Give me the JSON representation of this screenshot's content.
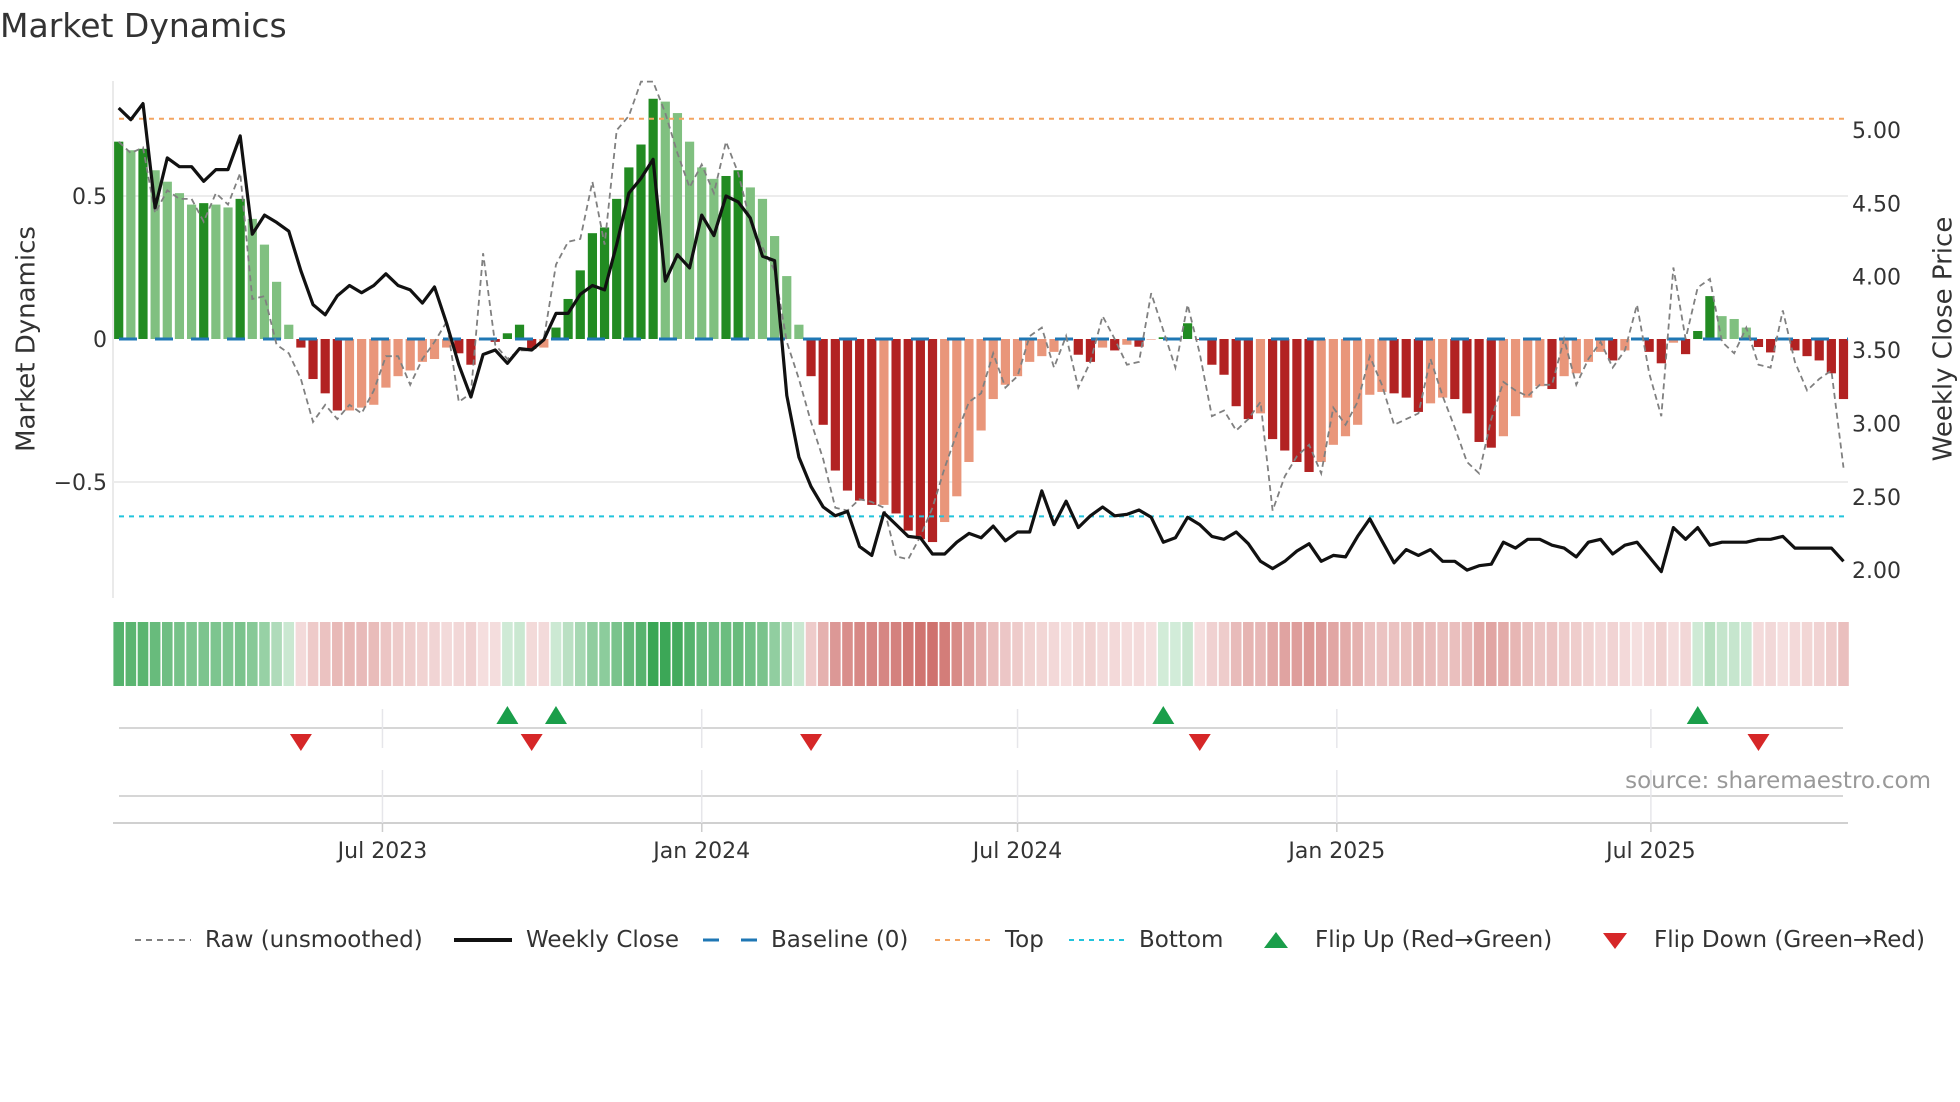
{
  "title": "Market Dynamics",
  "source": "source: sharemaestro.com",
  "legend": {
    "raw": "Raw (unsmoothed)",
    "close": "Weekly Close",
    "baseline": "Baseline (0)",
    "top": "Top",
    "bottom": "Bottom",
    "flip_up": "Flip Up (Red→Green)",
    "flip_down": "Flip Down (Green→Red)"
  },
  "colors": {
    "green_dark": "#228b22",
    "green_light": "#80c080",
    "red_dark": "#b22222",
    "red_light": "#e9967a",
    "raw": "#808080",
    "close": "#111111",
    "baseline": "#1f77b4",
    "top": "#f4a460",
    "bottom": "#22c3dc",
    "flip_up": "#1a9e4a",
    "flip_down": "#d62728"
  },
  "chart_data": {
    "type": "bar",
    "title": "Market Dynamics",
    "ylabel": "Market Dynamics",
    "y2label": "Weekly Close Price",
    "ylim": [
      -0.905,
      0.9
    ],
    "y2lim": [
      1.81,
      5.33
    ],
    "yticks": [
      {
        "v": 0.5,
        "label": "0.5"
      },
      {
        "v": 0,
        "label": "0"
      },
      {
        "v": -0.5,
        "label": "−0.5"
      }
    ],
    "y2ticks": [
      {
        "v": 5.0,
        "label": "5.00"
      },
      {
        "v": 4.5,
        "label": "4.50"
      },
      {
        "v": 4.0,
        "label": "4.00"
      },
      {
        "v": 3.5,
        "label": "3.50"
      },
      {
        "v": 3.0,
        "label": "3.00"
      },
      {
        "v": 2.5,
        "label": "2.50"
      },
      {
        "v": 2.0,
        "label": "2.00"
      }
    ],
    "xticks": [
      {
        "date": "2023-07-01",
        "label": "Jul 2023"
      },
      {
        "date": "2024-01-01",
        "label": "Jan 2024"
      },
      {
        "date": "2024-07-01",
        "label": "Jul 2024"
      },
      {
        "date": "2025-01-01",
        "label": "Jan 2025"
      },
      {
        "date": "2025-07-01",
        "label": "Jul 2025"
      }
    ],
    "top_level": 0.77,
    "bottom_level": -0.62,
    "baseline": 0,
    "grid": true,
    "legend_position": "bottom",
    "x": [
      "2023-01-30",
      "2023-02-06",
      "2023-02-13",
      "2023-02-20",
      "2023-02-27",
      "2023-03-06",
      "2023-03-13",
      "2023-03-20",
      "2023-03-27",
      "2023-04-03",
      "2023-04-10",
      "2023-04-17",
      "2023-04-24",
      "2023-05-01",
      "2023-05-08",
      "2023-05-15",
      "2023-05-22",
      "2023-05-29",
      "2023-06-05",
      "2023-06-12",
      "2023-06-19",
      "2023-06-26",
      "2023-07-03",
      "2023-07-10",
      "2023-07-17",
      "2023-07-24",
      "2023-07-31",
      "2023-08-07",
      "2023-08-14",
      "2023-08-21",
      "2023-08-28",
      "2023-09-04",
      "2023-09-11",
      "2023-09-18",
      "2023-09-25",
      "2023-10-02",
      "2023-10-09",
      "2023-10-16",
      "2023-10-23",
      "2023-10-30",
      "2023-11-06",
      "2023-11-13",
      "2023-11-20",
      "2023-11-27",
      "2023-12-04",
      "2023-12-11",
      "2023-12-18",
      "2023-12-25",
      "2024-01-01",
      "2024-01-08",
      "2024-01-15",
      "2024-01-22",
      "2024-01-29",
      "2024-02-05",
      "2024-02-12",
      "2024-02-19",
      "2024-02-26",
      "2024-03-04",
      "2024-03-11",
      "2024-03-18",
      "2024-03-25",
      "2024-04-01",
      "2024-04-08",
      "2024-04-15",
      "2024-04-22",
      "2024-04-29",
      "2024-05-06",
      "2024-05-13",
      "2024-05-20",
      "2024-05-27",
      "2024-06-03",
      "2024-06-10",
      "2024-06-17",
      "2024-06-24",
      "2024-07-01",
      "2024-07-08",
      "2024-07-15",
      "2024-07-22",
      "2024-07-29",
      "2024-08-05",
      "2024-08-12",
      "2024-08-19",
      "2024-08-26",
      "2024-09-02",
      "2024-09-09",
      "2024-09-16",
      "2024-09-23",
      "2024-09-30",
      "2024-10-07",
      "2024-10-14",
      "2024-10-21",
      "2024-10-28",
      "2024-11-04",
      "2024-11-11",
      "2024-11-18",
      "2024-11-25",
      "2024-12-02",
      "2024-12-09",
      "2024-12-16",
      "2024-12-23",
      "2024-12-30",
      "2025-01-06",
      "2025-01-13",
      "2025-01-20",
      "2025-01-27",
      "2025-02-03",
      "2025-02-10",
      "2025-02-17",
      "2025-02-24",
      "2025-03-03",
      "2025-03-10",
      "2025-03-17",
      "2025-03-24",
      "2025-03-31",
      "2025-04-07",
      "2025-04-14",
      "2025-04-21",
      "2025-04-28",
      "2025-05-05",
      "2025-05-12",
      "2025-05-19",
      "2025-05-26",
      "2025-06-02",
      "2025-06-09",
      "2025-06-16",
      "2025-06-23",
      "2025-06-30",
      "2025-07-07",
      "2025-07-14",
      "2025-07-21",
      "2025-07-28",
      "2025-08-04",
      "2025-08-11",
      "2025-08-18",
      "2025-08-25",
      "2025-09-01",
      "2025-09-08",
      "2025-09-15",
      "2025-09-22",
      "2025-09-29",
      "2025-10-06",
      "2025-10-13",
      "2025-10-20"
    ],
    "series": [
      {
        "name": "Market Dynamics",
        "kind": "bar",
        "values": [
          0.69,
          0.66,
          0.665,
          0.59,
          0.55,
          0.51,
          0.47,
          0.475,
          0.47,
          0.46,
          0.49,
          0.42,
          0.33,
          0.2,
          0.05,
          -0.03,
          -0.14,
          -0.19,
          -0.25,
          -0.25,
          -0.24,
          -0.23,
          -0.17,
          -0.13,
          -0.11,
          -0.08,
          -0.07,
          -0.03,
          -0.05,
          -0.09,
          -0.005,
          -0.01,
          0.02,
          0.05,
          -0.035,
          -0.03,
          0.04,
          0.14,
          0.24,
          0.37,
          0.39,
          0.49,
          0.6,
          0.68,
          0.84,
          0.83,
          0.79,
          0.69,
          0.6,
          0.56,
          0.57,
          0.59,
          0.53,
          0.49,
          0.36,
          0.22,
          0.05,
          -0.13,
          -0.3,
          -0.46,
          -0.53,
          -0.565,
          -0.58,
          -0.58,
          -0.61,
          -0.67,
          -0.7,
          -0.71,
          -0.64,
          -0.55,
          -0.43,
          -0.32,
          -0.21,
          -0.16,
          -0.13,
          -0.08,
          -0.06,
          -0.045,
          -0.005,
          -0.055,
          -0.08,
          -0.03,
          -0.04,
          -0.02,
          -0.027,
          -0.002,
          0.006,
          0.003,
          0.055,
          -0.003,
          -0.09,
          -0.125,
          -0.235,
          -0.28,
          -0.26,
          -0.35,
          -0.39,
          -0.43,
          -0.465,
          -0.43,
          -0.37,
          -0.34,
          -0.3,
          -0.195,
          -0.185,
          -0.19,
          -0.205,
          -0.255,
          -0.225,
          -0.205,
          -0.21,
          -0.26,
          -0.36,
          -0.38,
          -0.34,
          -0.27,
          -0.205,
          -0.165,
          -0.175,
          -0.13,
          -0.12,
          -0.08,
          -0.045,
          -0.075,
          -0.04,
          -0.002,
          -0.045,
          -0.085,
          -0.013,
          -0.053,
          0.028,
          0.15,
          0.08,
          0.07,
          0.04,
          -0.028,
          -0.047,
          -0.003,
          -0.04,
          -0.06,
          -0.075,
          -0.12,
          -0.21,
          -0.255
        ]
      },
      {
        "name": "Raw (unsmoothed)",
        "kind": "line",
        "values": [
          0.69,
          0.65,
          0.67,
          0.44,
          0.52,
          0.49,
          0.49,
          0.41,
          0.51,
          0.47,
          0.58,
          0.14,
          0.15,
          -0.02,
          -0.05,
          -0.14,
          -0.29,
          -0.23,
          -0.28,
          -0.23,
          -0.26,
          -0.18,
          -0.06,
          -0.06,
          -0.16,
          -0.07,
          -0.01,
          0.06,
          -0.22,
          -0.19,
          0.3,
          -0.02,
          -0.07,
          -0.04,
          -0.04,
          0.0,
          0.26,
          0.34,
          0.35,
          0.55,
          0.33,
          0.73,
          0.78,
          0.9,
          0.9,
          0.79,
          0.65,
          0.53,
          0.61,
          0.51,
          0.69,
          0.58,
          0.41,
          0.32,
          0.24,
          -0.01,
          -0.14,
          -0.29,
          -0.42,
          -0.59,
          -0.6,
          -0.56,
          -0.57,
          -0.59,
          -0.76,
          -0.77,
          -0.69,
          -0.59,
          -0.45,
          -0.33,
          -0.22,
          -0.19,
          -0.05,
          -0.17,
          -0.13,
          0.01,
          0.04,
          -0.1,
          0.01,
          -0.17,
          -0.08,
          0.08,
          0.0,
          -0.09,
          -0.08,
          0.16,
          0.03,
          -0.1,
          0.12,
          -0.05,
          -0.27,
          -0.25,
          -0.32,
          -0.28,
          -0.22,
          -0.6,
          -0.48,
          -0.41,
          -0.37,
          -0.47,
          -0.24,
          -0.3,
          -0.22,
          -0.06,
          -0.16,
          -0.3,
          -0.28,
          -0.26,
          -0.07,
          -0.2,
          -0.31,
          -0.43,
          -0.47,
          -0.28,
          -0.15,
          -0.18,
          -0.2,
          -0.16,
          -0.16,
          0.0,
          -0.16,
          -0.07,
          -0.01,
          -0.1,
          -0.04,
          0.12,
          -0.12,
          -0.27,
          0.25,
          0.0,
          0.18,
          0.21,
          -0.01,
          -0.05,
          0.04,
          -0.09,
          -0.1,
          0.1,
          -0.08,
          -0.18,
          -0.14,
          -0.11,
          -0.45,
          -0.35
        ]
      },
      {
        "name": "Weekly Close",
        "kind": "line",
        "axis": "right",
        "values": [
          5.15,
          5.07,
          5.18,
          4.47,
          4.81,
          4.75,
          4.75,
          4.65,
          4.73,
          4.73,
          4.96,
          4.29,
          4.42,
          4.37,
          4.31,
          4.04,
          3.81,
          3.74,
          3.87,
          3.94,
          3.89,
          3.94,
          4.02,
          3.94,
          3.91,
          3.82,
          3.93,
          3.68,
          3.4,
          3.18,
          3.47,
          3.5,
          3.41,
          3.51,
          3.5,
          3.57,
          3.75,
          3.75,
          3.88,
          3.94,
          3.91,
          4.22,
          4.57,
          4.67,
          4.8,
          3.97,
          4.15,
          4.06,
          4.42,
          4.28,
          4.55,
          4.51,
          4.4,
          4.14,
          4.11,
          3.19,
          2.77,
          2.57,
          2.43,
          2.37,
          2.4,
          2.16,
          2.1,
          2.39,
          2.31,
          2.23,
          2.22,
          2.11,
          2.11,
          2.19,
          2.25,
          2.22,
          2.3,
          2.2,
          2.26,
          2.26,
          2.54,
          2.31,
          2.47,
          2.29,
          2.37,
          2.43,
          2.37,
          2.38,
          2.41,
          2.36,
          2.19,
          2.22,
          2.36,
          2.31,
          2.23,
          2.21,
          2.26,
          2.18,
          2.06,
          2.01,
          2.06,
          2.13,
          2.18,
          2.06,
          2.1,
          2.09,
          2.23,
          2.35,
          2.2,
          2.05,
          2.14,
          2.1,
          2.14,
          2.06,
          2.06,
          2.0,
          2.03,
          2.04,
          2.19,
          2.15,
          2.21,
          2.21,
          2.17,
          2.15,
          2.09,
          2.19,
          2.21,
          2.11,
          2.17,
          2.19,
          2.09,
          1.99,
          2.29,
          2.21,
          2.29,
          2.17,
          2.19,
          2.19,
          2.19,
          2.21,
          2.21,
          2.23,
          2.15,
          2.15,
          2.15,
          2.15,
          2.06,
          2.06
        ]
      }
    ]
  }
}
